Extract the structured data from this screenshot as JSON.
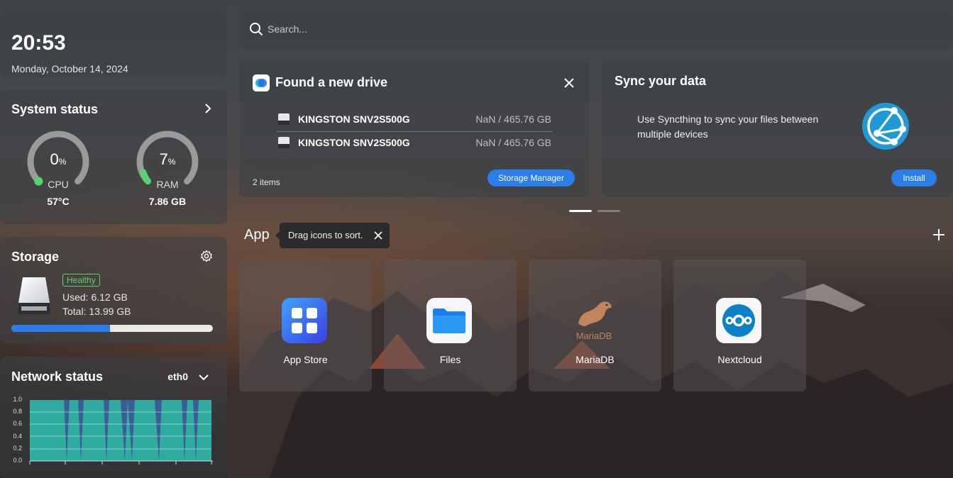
{
  "clock": {
    "time": "20:53",
    "date": "Monday, October 14, 2024"
  },
  "system_status": {
    "title": "System status",
    "cpu": {
      "value": "0",
      "unit": "%",
      "label": "CPU",
      "sub": "57°C",
      "percent": 0
    },
    "ram": {
      "value": "7",
      "unit": "%",
      "label": "RAM",
      "sub": "7.86 GB",
      "percent": 7
    }
  },
  "storage": {
    "title": "Storage",
    "badge": "Healthy",
    "used": "Used: 6.12 GB",
    "total": "Total: 13.99 GB",
    "used_fraction": 0.49
  },
  "network": {
    "title": "Network status",
    "interface": "eth0",
    "y_ticks": [
      "1.0",
      "0.8",
      "0.6",
      "0.4",
      "0.2",
      "0.0"
    ]
  },
  "search": {
    "placeholder": "Search..."
  },
  "drive_card": {
    "title": "Found a new drive",
    "drives": [
      {
        "name": "KINGSTON SNV2S500G",
        "size": "NaN / 465.76 GB"
      },
      {
        "name": "KINGSTON SNV2S500G",
        "size": "NaN / 465.76 GB"
      }
    ],
    "items_count": "2 items",
    "button": "Storage Manager"
  },
  "sync_card": {
    "title": "Sync your data",
    "description": "Use Syncthing to sync your files between multiple devices",
    "button": "Install"
  },
  "carousel": {
    "active_index": 0,
    "count": 2
  },
  "apps_section": {
    "title": "App",
    "tooltip": "Drag icons to sort."
  },
  "apps": [
    {
      "name": "App Store",
      "icon": "app-store-icon"
    },
    {
      "name": "Files",
      "icon": "files-icon"
    },
    {
      "name": "MariaDB",
      "icon": "mariadb-icon",
      "logo_text": "MariaDB"
    },
    {
      "name": "Nextcloud",
      "icon": "nextcloud-icon"
    }
  ],
  "colors": {
    "accent": "#2b7de9",
    "healthy": "#57d36f",
    "gauge_dot": "#57d36f",
    "network": "#2fb3a0"
  }
}
